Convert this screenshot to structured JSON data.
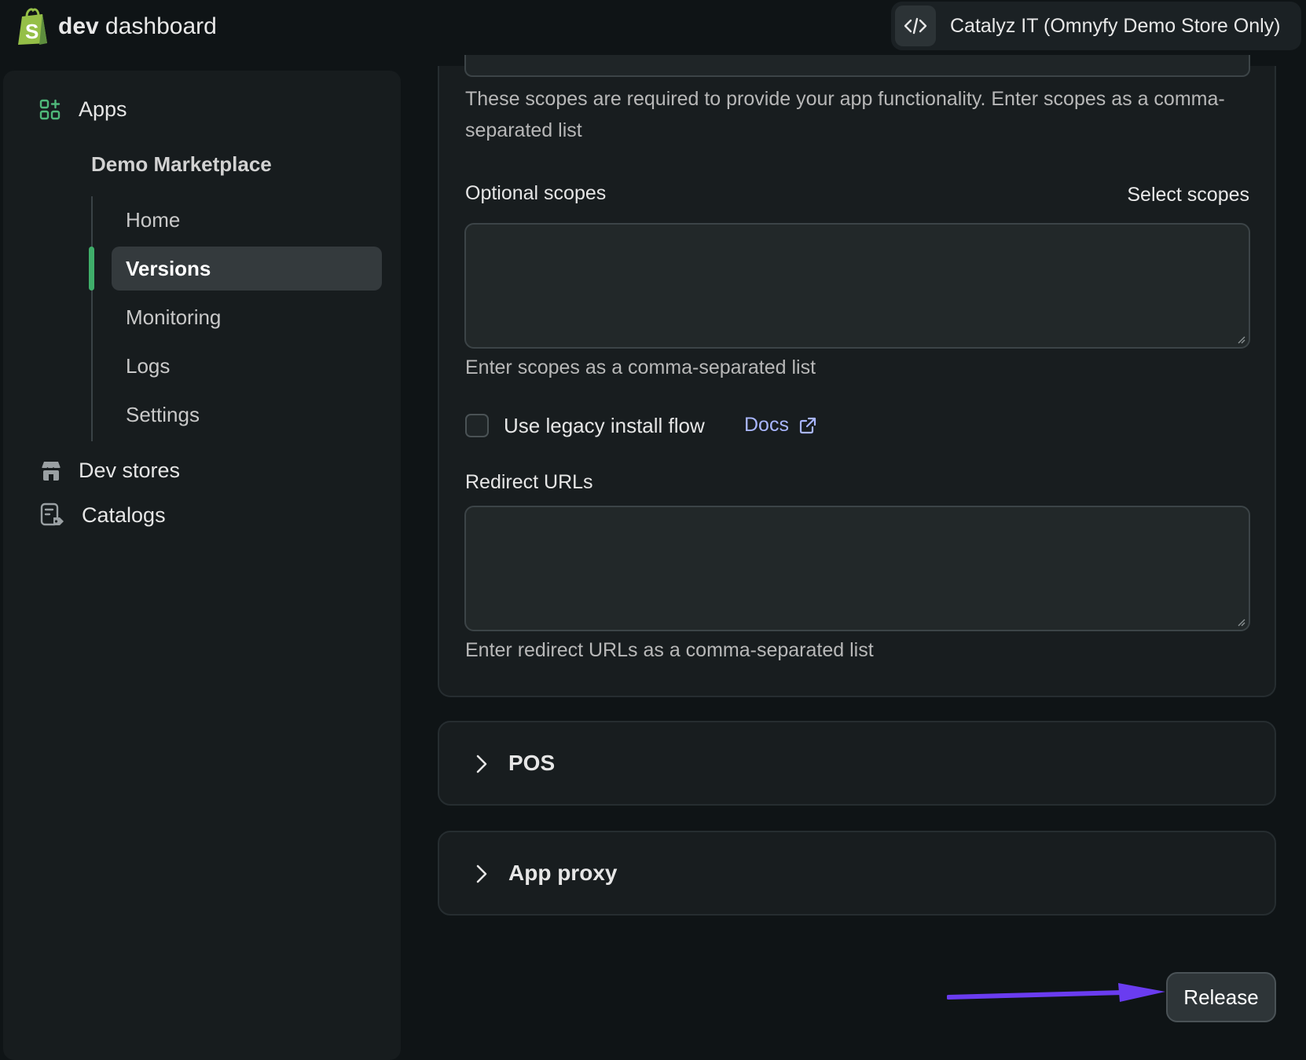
{
  "header": {
    "brand_bold": "dev",
    "brand_rest": " dashboard",
    "store_name": "Catalyz IT (Omnyfy Demo Store Only)",
    "logo_icon": "shopify-bag-icon",
    "code_icon": "code-icon"
  },
  "sidebar": {
    "apps_label": "Apps",
    "app_name": "Demo Marketplace",
    "sub_items": [
      {
        "label": "Home"
      },
      {
        "label": "Versions",
        "active": true
      },
      {
        "label": "Monitoring"
      },
      {
        "label": "Logs"
      },
      {
        "label": "Settings"
      }
    ],
    "dev_stores_label": "Dev stores",
    "catalogs_label": "Catalogs"
  },
  "access": {
    "required_scopes_help": "These scopes are required to provide your app functionality. Enter scopes as a comma-separated list",
    "optional_scopes_label": "Optional scopes",
    "select_scopes_label": "Select scopes",
    "optional_scopes_value": "",
    "optional_scopes_help": "Enter scopes as a comma-separated list",
    "legacy_install_label": "Use legacy install flow",
    "legacy_install_checked": false,
    "docs_label": "Docs",
    "redirect_urls_label": "Redirect URLs",
    "redirect_urls_value": "",
    "redirect_urls_help": "Enter redirect URLs as a comma-separated list"
  },
  "sections": {
    "pos_title": "POS",
    "app_proxy_title": "App proxy"
  },
  "footer": {
    "release_label": "Release"
  },
  "colors": {
    "accent_green": "#3fae6a",
    "link": "#a9b6ff",
    "annotation_arrow": "#6a3cf0"
  }
}
